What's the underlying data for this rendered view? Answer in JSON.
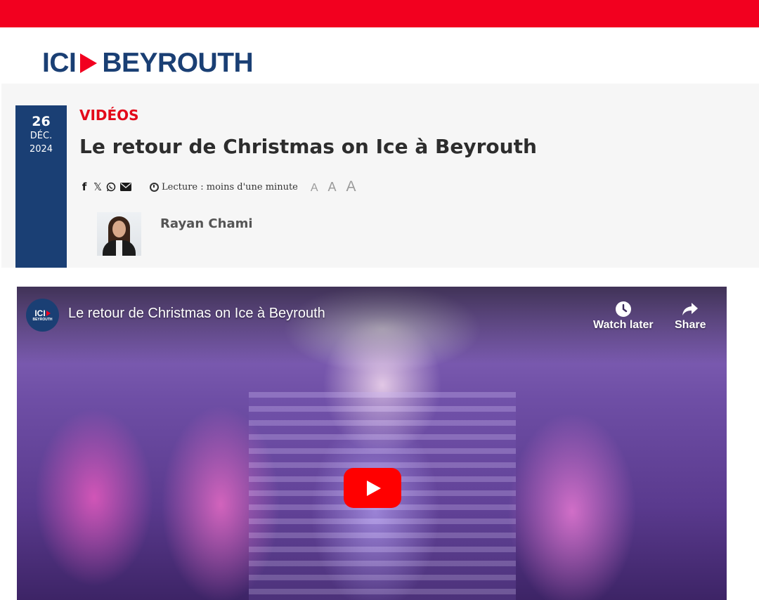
{
  "site": {
    "logo_left": "ICI",
    "logo_right": "BEYROUTH",
    "brand_colors": {
      "red": "#f2001f",
      "navy": "#1a3f74"
    }
  },
  "article": {
    "date": {
      "day": "26",
      "month": "DÉC.",
      "year": "2024"
    },
    "category": "VIDÉOS",
    "title": "Le retour de Christmas on Ice à Beyrouth",
    "share_icons": [
      "facebook-icon",
      "x-icon",
      "whatsapp-icon",
      "email-icon"
    ],
    "share_labels": {
      "facebook": "f",
      "x": "𝕏"
    },
    "reading_time": "Lecture : moins d'une minute",
    "font_size_controls": [
      "A",
      "A",
      "A"
    ],
    "author": "Rayan Chami"
  },
  "video": {
    "channel_logo": {
      "top": "ICI",
      "bottom": "BEYROUTH"
    },
    "title": "Le retour de Christmas on Ice à Beyrouth",
    "watch_later_label": "Watch later",
    "share_label": "Share",
    "play_button_color": "#ff0000"
  }
}
